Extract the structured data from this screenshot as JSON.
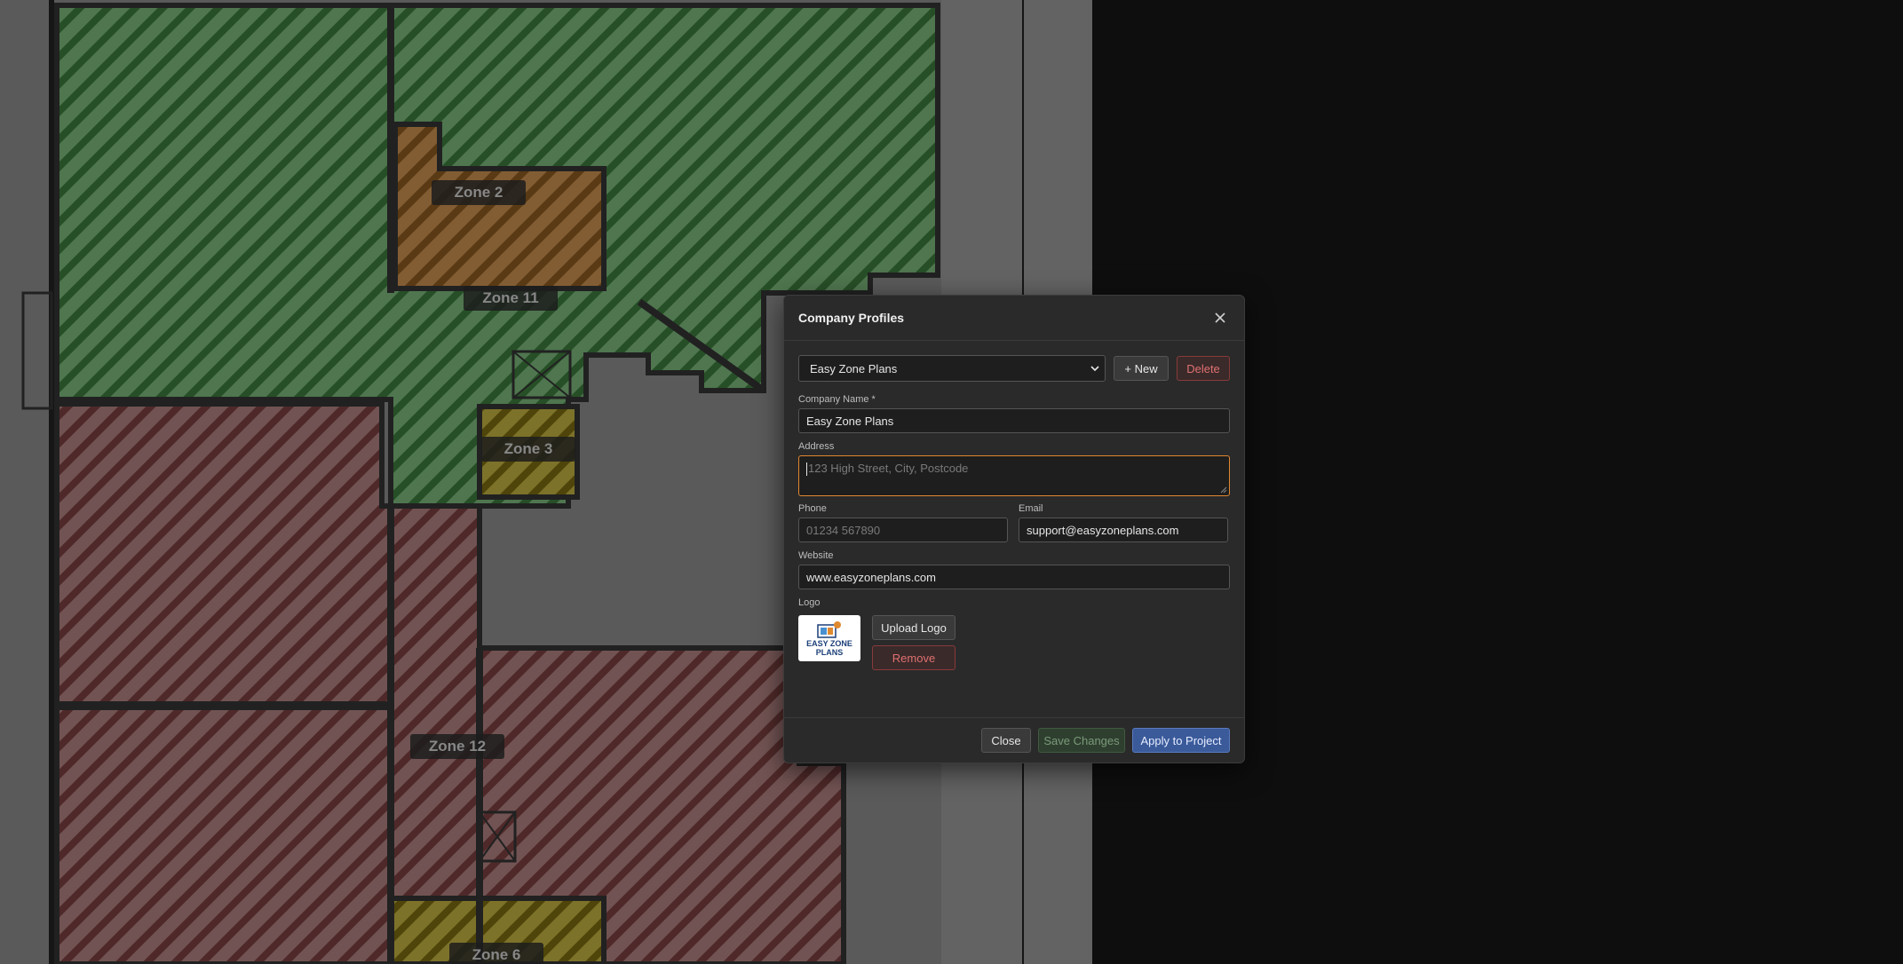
{
  "zones": [
    {
      "name": "Zone 2"
    },
    {
      "name": "Zone 11"
    },
    {
      "name": "Zone 3"
    },
    {
      "name": "Zone 12"
    },
    {
      "name": "Zone 6"
    }
  ],
  "colors": {
    "zone_green": "#7ab57a",
    "zone_red": "#b07070",
    "zone_orange": "#c89050",
    "zone_yellow": "#b8aa40",
    "accent_orange": "#e0862f",
    "danger": "#e07070",
    "primary": "#3a5a9a"
  },
  "dialog": {
    "title": "Company Profiles",
    "profile_select": {
      "value": "Easy Zone Plans"
    },
    "new_label": "+ New",
    "delete_label": "Delete",
    "company_name": {
      "label": "Company Name *",
      "value": "Easy Zone Plans"
    },
    "address": {
      "label": "Address",
      "placeholder": "123 High Street, City, Postcode"
    },
    "phone": {
      "label": "Phone",
      "placeholder": "01234 567890"
    },
    "email": {
      "label": "Email",
      "value": "support@easyzoneplans.com"
    },
    "website": {
      "label": "Website",
      "value": "www.easyzoneplans.com"
    },
    "logo": {
      "label": "Logo",
      "line1": "EASY ZONE",
      "line2": "PLANS",
      "upload_label": "Upload Logo",
      "remove_label": "Remove"
    },
    "footer": {
      "close_label": "Close",
      "save_label": "Save Changes",
      "apply_label": "Apply to Project"
    }
  }
}
